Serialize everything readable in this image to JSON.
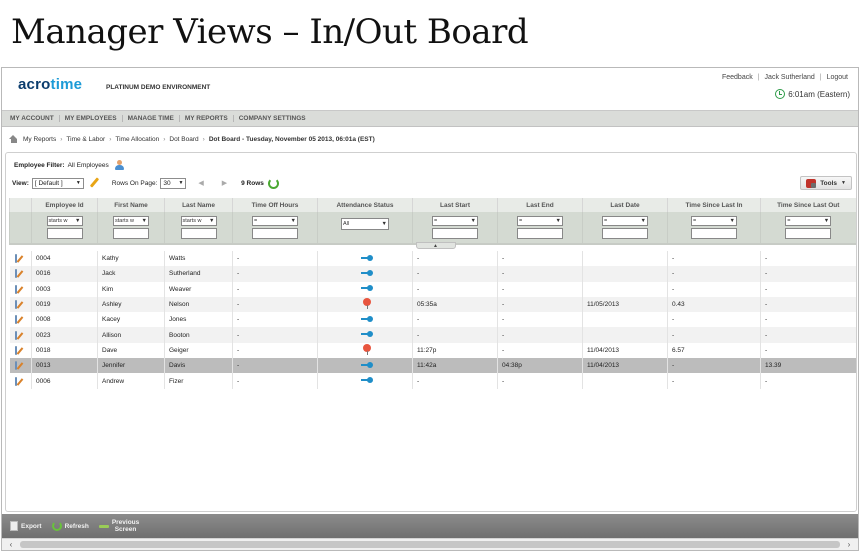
{
  "slide": {
    "title": "Manager Views – In/Out Board"
  },
  "header": {
    "logo_main": "acro",
    "logo_accent": "time",
    "environment": "PLATINUM DEMO ENVIRONMENT",
    "links": [
      "Feedback",
      "Jack Sutherland",
      "Logout"
    ],
    "clock": "6:01am (Eastern)"
  },
  "nav": [
    "MY ACCOUNT",
    "MY EMPLOYEES",
    "MANAGE TIME",
    "MY REPORTS",
    "COMPANY SETTINGS"
  ],
  "breadcrumb": {
    "items": [
      "My Reports",
      "Time & Labor",
      "Time Allocation",
      "Dot Board"
    ],
    "current": "Dot Board - Tuesday, November 05 2013, 06:01a (EST)"
  },
  "filter": {
    "label": "Employee Filter:",
    "value": "All Employees"
  },
  "toolbar": {
    "view_label": "View:",
    "view_value": "[ Default ]",
    "rows_label": "Rows On Page:",
    "rows_value": "30",
    "pager": "◀ ▶",
    "rows_count": "9 Rows",
    "tools_label": "Tools"
  },
  "grid": {
    "columns": [
      "",
      "Employee Id",
      "First Name",
      "Last Name",
      "Time Off Hours",
      "Attendance Status",
      "Last Start",
      "Last End",
      "Last Date",
      "Time Since Last In",
      "Time Since Last Out"
    ],
    "filters": {
      "text_op": "starts w",
      "eq_op": "=",
      "status": "All"
    },
    "rows": [
      {
        "id": "0004",
        "first": "Kathy",
        "last": "Watts",
        "off": "-",
        "status": "in",
        "start": "-",
        "end": "-",
        "date": "",
        "since_in": "-",
        "since_out": "-"
      },
      {
        "id": "0016",
        "first": "Jack",
        "last": "Sutherland",
        "off": "-",
        "status": "in",
        "start": "-",
        "end": "-",
        "date": "",
        "since_in": "-",
        "since_out": "-"
      },
      {
        "id": "0003",
        "first": "Kim",
        "last": "Weaver",
        "off": "-",
        "status": "in",
        "start": "-",
        "end": "-",
        "date": "",
        "since_in": "-",
        "since_out": "-"
      },
      {
        "id": "0019",
        "first": "Ashley",
        "last": "Nelson",
        "off": "-",
        "status": "out",
        "start": "05:35a",
        "end": "-",
        "date": "11/05/2013",
        "since_in": "0.43",
        "since_out": "-"
      },
      {
        "id": "0008",
        "first": "Kacey",
        "last": "Jones",
        "off": "-",
        "status": "in",
        "start": "-",
        "end": "-",
        "date": "",
        "since_in": "-",
        "since_out": "-"
      },
      {
        "id": "0023",
        "first": "Allison",
        "last": "Booton",
        "off": "-",
        "status": "in",
        "start": "-",
        "end": "-",
        "date": "",
        "since_in": "-",
        "since_out": "-"
      },
      {
        "id": "0018",
        "first": "Dave",
        "last": "Geiger",
        "off": "-",
        "status": "out",
        "start": "11:27p",
        "end": "-",
        "date": "11/04/2013",
        "since_in": "6.57",
        "since_out": "-"
      },
      {
        "id": "0013",
        "first": "Jennifer",
        "last": "Davis",
        "off": "-",
        "status": "in",
        "start": "11:42a",
        "end": "04:38p",
        "date": "11/04/2013",
        "since_in": "-",
        "since_out": "13.39",
        "selected": true
      },
      {
        "id": "0006",
        "first": "Andrew",
        "last": "Fizer",
        "off": "-",
        "status": "in",
        "start": "-",
        "end": "-",
        "date": "",
        "since_in": "-",
        "since_out": "-"
      }
    ]
  },
  "footer": {
    "export": "Export",
    "refresh": "Refresh",
    "previous_line1": "Previous",
    "previous_line2": "Screen"
  }
}
